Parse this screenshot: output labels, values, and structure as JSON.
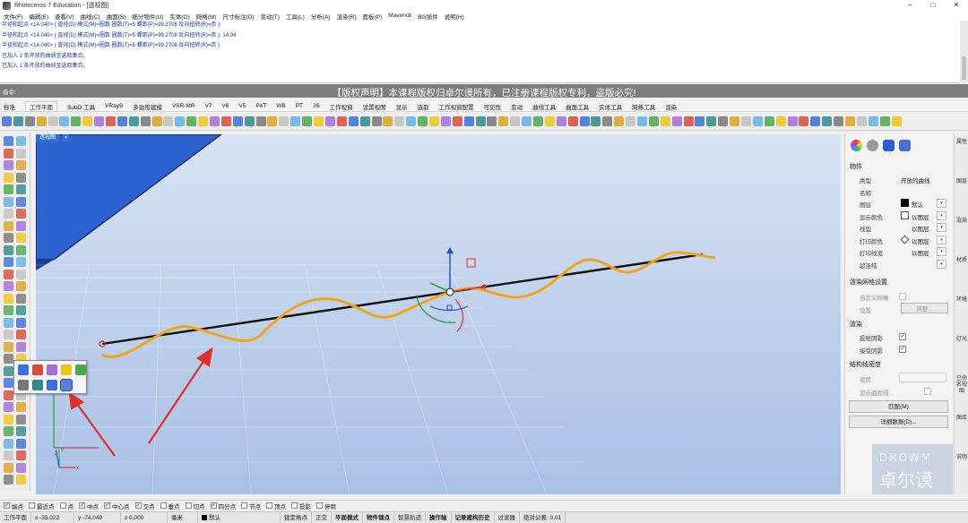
{
  "window": {
    "title": "Rhinoceros 7 Education - [透视图]"
  },
  "menu": [
    "文件(F)",
    "编辑(E)",
    "查看(V)",
    "曲线(C)",
    "曲面(S)",
    "细分物件(U)",
    "实体(O)",
    "网格(M)",
    "尺寸标注(D)",
    "变动(T)",
    "工具(L)",
    "分析(A)",
    "渲染(R)",
    "面板(P)",
    "Maverick",
    "BG插件",
    "说明(H)"
  ],
  "history": [
    "半径和起点 <14.040> ( 直径(D)  模式(M)=圈数  圈数(T)=5  螺距(P)=99.2708  反向扭转(R)=否 ):",
    "半径和起点 <14.040> ( 直径(D)  模式(M)=圈数  圈数(T)=5  螺距(P)=99.2708  反向扭转(R)=否 ): 14.04",
    "半径和起点 <14.040> ( 直径(D)  模式(M)=圈数  圈数(T)=5  螺距(P)=99.2708  反向扭转(R)=否 )",
    "已加入 1 条开放的曲线至选取集合。",
    "已加入 1 条开放的曲线至选取集合。"
  ],
  "command": {
    "prompt": "指令:",
    "banner": "【版权声明】本课程版权归卓尔谟所有，已注册课程版权专利，盗版必究!"
  },
  "toolbar_tabs": [
    "标准",
    "工作平面",
    "SubD 工具",
    "VRayS",
    "多边形建模",
    "VSR-MR",
    "V7",
    "V6",
    "V5",
    "PeT",
    "WB",
    "PT",
    "JS",
    "工作视窗",
    "设置视图",
    "显示",
    "选取",
    "工作视窗配置",
    "可见性",
    "变动",
    "曲线工具",
    "曲面工具",
    "实体工具",
    "网格工具",
    "渲染"
  ],
  "viewport": {
    "label": "透视图"
  },
  "panel": {
    "section_object": "物件",
    "rows": [
      {
        "label": "类型",
        "value": "开放的曲线"
      },
      {
        "label": "名称",
        "value": ""
      },
      {
        "label": "图层",
        "value": "默认"
      },
      {
        "label": "显示颜色",
        "value": "以图层"
      },
      {
        "label": "线型",
        "value": "以图层"
      },
      {
        "label": "打印颜色",
        "value": "以图层"
      },
      {
        "label": "打印线宽",
        "value": "以图层"
      },
      {
        "label": "超连结",
        "value": ""
      }
    ],
    "section_render_mesh": "渲染网格设置",
    "custom_mesh": "自定义网格",
    "settings_label": "设置",
    "adjust_button": "调整...",
    "section_render": "渲染",
    "cast_shadows": "投射阴影",
    "receive_shadows": "接受阴影",
    "section_isocurve": "结构线密度",
    "density": "密度",
    "show_surface_isocurves": "显示曲面结...",
    "match_button": "匹配(M)",
    "details_button": "详细数据(D)..."
  },
  "side_tabs": [
    "属性",
    "图层",
    "渲染",
    "材质",
    "环境",
    "灯光",
    "已命名视图",
    "图库",
    "说明"
  ],
  "osnaps": [
    {
      "label": "端点",
      "checked": true
    },
    {
      "label": "最近点",
      "checked": false
    },
    {
      "label": "点",
      "checked": false
    },
    {
      "label": "中点",
      "checked": true
    },
    {
      "label": "中心点",
      "checked": true
    },
    {
      "label": "交点",
      "checked": true
    },
    {
      "label": "垂点",
      "checked": false
    },
    {
      "label": "切点",
      "checked": false
    },
    {
      "label": "四分点",
      "checked": true
    },
    {
      "label": "节点",
      "checked": false
    },
    {
      "label": "顶点",
      "checked": false
    },
    {
      "label": "投影",
      "checked": false
    },
    {
      "label": "停用",
      "checked": false
    }
  ],
  "status": {
    "cplane": "工作平面",
    "x": "x -35.022",
    "y": "y -74.049",
    "z": "z 0.000",
    "unit": "毫米",
    "layer": "默认",
    "lock_grid": "锁定格点",
    "ortho": "正交",
    "planar": "平面模式",
    "osnap": "物件锁点",
    "smarttrack": "智慧轨迹",
    "gumball": "操作轴",
    "history": "记录建构历史",
    "filter": "过滤器",
    "tolerance": "绝对公差: 0.01"
  },
  "watermark": {
    "line1": "DROWM",
    "line2": "卓尔谟"
  },
  "colors": {
    "viewport_top": "#d8e4f5",
    "viewport_bottom": "#a9c1e6",
    "curve": "#f2a51c",
    "axis_line": "#111111",
    "arrow": "#e0302a",
    "plane": "#2c62cf"
  }
}
